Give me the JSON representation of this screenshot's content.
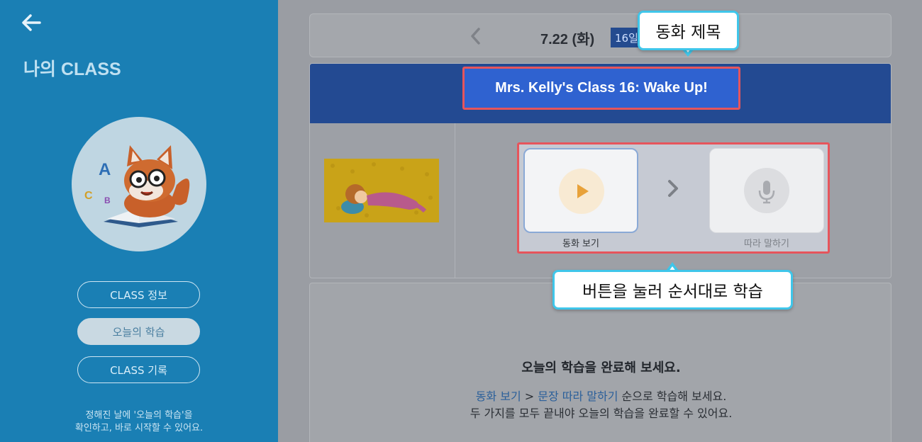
{
  "sidebar": {
    "title": "나의 CLASS",
    "buttons": [
      {
        "label": "CLASS 정보",
        "active": false
      },
      {
        "label": "오늘의 학습",
        "active": true
      },
      {
        "label": "CLASS 기록",
        "active": false
      }
    ],
    "note_line1": "정해진 날에 '오늘의 학습'을",
    "note_line2": "확인하고, 바로 시작할 수 있어요.",
    "avatar_icon": "fox-mascot-icon"
  },
  "date_bar": {
    "date": "7.22 (화)",
    "day_badge": "16일"
  },
  "class": {
    "title": "Mrs. Kelly's Class 16: Wake Up!",
    "thumbnail": "sleeping-girl-thumbnail",
    "steps": [
      {
        "label": "동화 보기",
        "icon": "play-icon",
        "enabled": true
      },
      {
        "label": "따라 말하기",
        "icon": "microphone-icon",
        "enabled": false
      }
    ]
  },
  "completion": {
    "title": "오늘의 학습을 완료해 보세요.",
    "guide_step1": "동화 보기",
    "guide_sep": " > ",
    "guide_step2": "문장 따라 말하기",
    "guide_rest": " 순으로 학습해 보세요.",
    "guide_line2": "두 가지를 모두 끝내야 오늘의 학습을 완료할 수 있어요."
  },
  "callouts": {
    "top": "동화 제목",
    "bottom": "버튼을 눌러 순서대로 학습"
  },
  "colors": {
    "sidebar_bg": "#1a7fb4",
    "header_bg": "#234a92",
    "highlight_border": "#e6555c",
    "callout_border": "#3fc6ea"
  }
}
